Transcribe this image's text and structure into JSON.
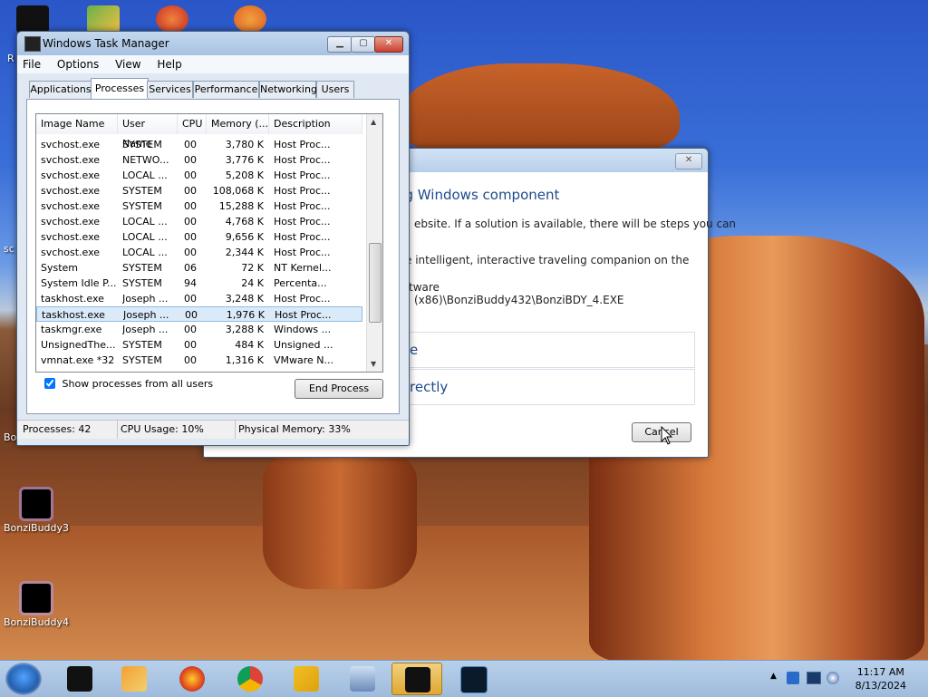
{
  "desktop": {
    "icons": [
      {
        "label": "BonziBuddy3"
      },
      {
        "label": "BonziBuddy4"
      }
    ],
    "partial_labels": [
      "R",
      "sc",
      "Bo"
    ]
  },
  "error_dialog": {
    "heading": "ng Windows component",
    "line1": "ebsite. If a solution is available, there will be steps you can",
    "line2": "e intelligent, interactive traveling companion on the",
    "line3": "ftware",
    "line4": "(x86)\\BonziBuddy432\\BonziBDY_4.EXE",
    "option1": "e",
    "option2": "rectly",
    "cancel_label": "Cancel"
  },
  "task_manager": {
    "title": "Windows Task Manager",
    "menu": [
      "File",
      "Options",
      "View",
      "Help"
    ],
    "tabs": [
      "Applications",
      "Processes",
      "Services",
      "Performance",
      "Networking",
      "Users"
    ],
    "active_tab": "Processes",
    "columns": [
      "Image Name",
      "User Name",
      "CPU",
      "Memory (...",
      "Description"
    ],
    "rows": [
      {
        "name": "svchost.exe",
        "user": "SYSTEM",
        "cpu": "00",
        "mem": "3,780 K",
        "desc": "Host Proc..."
      },
      {
        "name": "svchost.exe",
        "user": "NETWO...",
        "cpu": "00",
        "mem": "3,776 K",
        "desc": "Host Proc..."
      },
      {
        "name": "svchost.exe",
        "user": "LOCAL ...",
        "cpu": "00",
        "mem": "5,208 K",
        "desc": "Host Proc..."
      },
      {
        "name": "svchost.exe",
        "user": "SYSTEM",
        "cpu": "00",
        "mem": "108,068 K",
        "desc": "Host Proc..."
      },
      {
        "name": "svchost.exe",
        "user": "SYSTEM",
        "cpu": "00",
        "mem": "15,288 K",
        "desc": "Host Proc..."
      },
      {
        "name": "svchost.exe",
        "user": "LOCAL ...",
        "cpu": "00",
        "mem": "4,768 K",
        "desc": "Host Proc..."
      },
      {
        "name": "svchost.exe",
        "user": "LOCAL ...",
        "cpu": "00",
        "mem": "9,656 K",
        "desc": "Host Proc..."
      },
      {
        "name": "svchost.exe",
        "user": "LOCAL ...",
        "cpu": "00",
        "mem": "2,344 K",
        "desc": "Host Proc..."
      },
      {
        "name": "System",
        "user": "SYSTEM",
        "cpu": "06",
        "mem": "72 K",
        "desc": "NT Kernel..."
      },
      {
        "name": "System Idle P...",
        "user": "SYSTEM",
        "cpu": "94",
        "mem": "24 K",
        "desc": "Percenta..."
      },
      {
        "name": "taskhost.exe",
        "user": "Joseph ...",
        "cpu": "00",
        "mem": "3,248 K",
        "desc": "Host Proc..."
      },
      {
        "name": "taskhost.exe",
        "user": "Joseph ...",
        "cpu": "00",
        "mem": "1,976 K",
        "desc": "Host Proc..."
      },
      {
        "name": "taskmgr.exe",
        "user": "Joseph ...",
        "cpu": "00",
        "mem": "3,288 K",
        "desc": "Windows ..."
      },
      {
        "name": "UnsignedThe...",
        "user": "SYSTEM",
        "cpu": "00",
        "mem": "484 K",
        "desc": "Unsigned ..."
      },
      {
        "name": "vmnat.exe *32",
        "user": "SYSTEM",
        "cpu": "00",
        "mem": "1,316 K",
        "desc": "VMware N..."
      }
    ],
    "selected_row": 11,
    "show_all_label": "Show processes from all users",
    "show_all_checked": true,
    "end_process_label": "End Process",
    "status": {
      "processes": "Processes: 42",
      "cpu": "CPU Usage: 10%",
      "memory": "Physical Memory: 33%"
    }
  },
  "taskbar": {
    "items": [
      "explorer-icon",
      "media-player-icon",
      "firefox-icon",
      "chrome-icon",
      "network-app-icon",
      "keyboard-app-icon",
      "task-manager-app-icon",
      "performance-monitor-icon"
    ],
    "clock_time": "11:17 AM",
    "clock_date": "8/13/2024"
  },
  "colors": {
    "link_blue": "#1e4b8c",
    "taskbar": "#a8c2e2",
    "active_taskbar": "#e0a830"
  }
}
